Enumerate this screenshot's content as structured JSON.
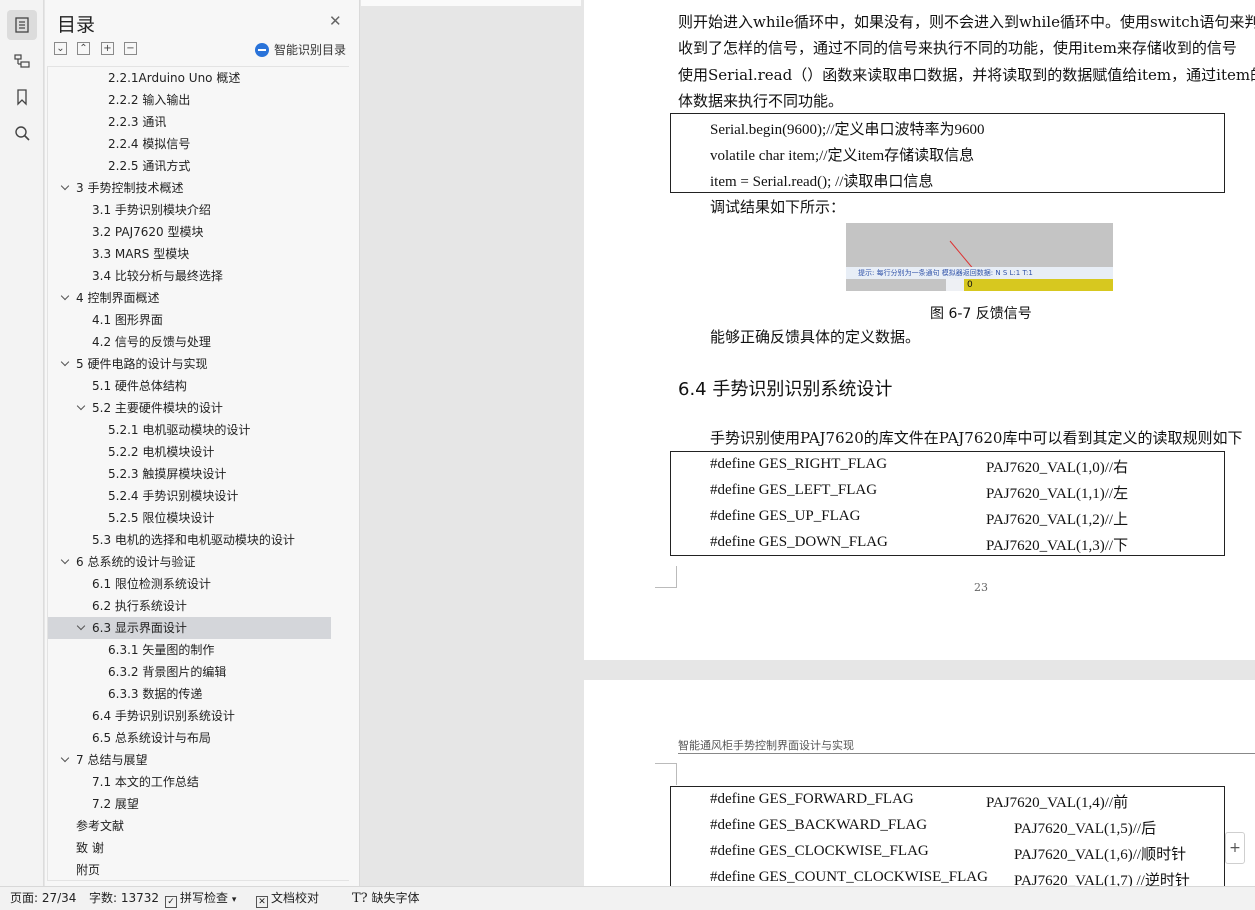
{
  "toc": {
    "title": "目录",
    "smart_toc_label": "智能识别目录",
    "items": [
      {
        "label": "2.2.1Arduino Uno 概述",
        "level": 3
      },
      {
        "label": "2.2.2 输入输出",
        "level": 3
      },
      {
        "label": "2.2.3 通讯",
        "level": 3
      },
      {
        "label": "2.2.4 模拟信号",
        "level": 3
      },
      {
        "label": "2.2.5 通讯方式",
        "level": 3
      },
      {
        "label": "3  手势控制技术概述",
        "level": 1,
        "expanded": true
      },
      {
        "label": "3.1 手势识别模块介绍",
        "level": 2
      },
      {
        "label": "3.2 PAJ7620 型模块",
        "level": 2
      },
      {
        "label": "3.3 MARS 型模块",
        "level": 2
      },
      {
        "label": "3.4 比较分析与最终选择",
        "level": 2
      },
      {
        "label": "4  控制界面概述",
        "level": 1,
        "expanded": true
      },
      {
        "label": "4.1 图形界面",
        "level": 2
      },
      {
        "label": "4.2 信号的反馈与处理",
        "level": 2
      },
      {
        "label": "5  硬件电路的设计与实现",
        "level": 1,
        "expanded": true
      },
      {
        "label": "5.1 硬件总体结构",
        "level": 2
      },
      {
        "label": "5.2 主要硬件模块的设计",
        "level": 2,
        "expanded": true
      },
      {
        "label": "5.2.1 电机驱动模块的设计",
        "level": 3
      },
      {
        "label": "5.2.2 电机模块设计",
        "level": 3
      },
      {
        "label": "5.2.3 触摸屏模块设计",
        "level": 3
      },
      {
        "label": "5.2.4 手势识别模块设计",
        "level": 3
      },
      {
        "label": "5.2.5 限位模块设计",
        "level": 3
      },
      {
        "label": "5.3 电机的选择和电机驱动模块的设计",
        "level": 2
      },
      {
        "label": "6  总系统的设计与验证",
        "level": 1,
        "expanded": true
      },
      {
        "label": "6.1 限位检测系统设计",
        "level": 2
      },
      {
        "label": "6.2 执行系统设计",
        "level": 2
      },
      {
        "label": "6.3 显示界面设计",
        "level": 2,
        "expanded": true,
        "selected": true
      },
      {
        "label": "6.3.1 矢量图的制作",
        "level": 3
      },
      {
        "label": "6.3.2 背景图片的编辑",
        "level": 3
      },
      {
        "label": "6.3.3 数据的传递",
        "level": 3
      },
      {
        "label": "6.4 手势识别识别系统设计",
        "level": 2
      },
      {
        "label": "6.5 总系统设计与布局",
        "level": 2
      },
      {
        "label": "7  总结与展望",
        "level": 1,
        "expanded": true
      },
      {
        "label": "7.1 本文的工作总结",
        "level": 2
      },
      {
        "label": "7.2 展望",
        "level": 2
      },
      {
        "label": "参考文献",
        "level": 1
      },
      {
        "label": "致    谢",
        "level": 1
      },
      {
        "label": "附页",
        "level": 1
      }
    ]
  },
  "doc": {
    "para1": [
      "则开始进入while循环中，如果没有，则不会进入到while循环中。使用switch语句来判断",
      "收到了怎样的信号，通过不同的信号来执行不同的功能，使用item来存储收到的信号",
      "使用Serial.read（）函数来读取串口数据，并将读取到的数据赋值给item，通过item的",
      "体数据来执行不同功能。"
    ],
    "code1": [
      "Serial.begin(9600);//定义串口波特率为9600",
      "volatile char item;//定义item存储读取信息",
      "item = Serial.read(); //读取串口信息"
    ],
    "debug_text": "调试结果如下所示：",
    "figure_hint": "提示: 每行分别为一条通句     模拟器返回数据:  N  S     L:1     T:1",
    "figure_value": "0",
    "figure_caption": "图 6-7 反馈信号",
    "after_fig": "能够正确反馈具体的定义数据。",
    "section_heading": "6.4 手势识别识别系统设计",
    "section_para": "手势识别使用PAJ7620的库文件在PAJ7620库中可以看到其定义的读取规则如下",
    "code2": [
      {
        "name": "#define GES_RIGHT_FLAG",
        "value": "PAJ7620_VAL(1,0)//右"
      },
      {
        "name": "#define GES_LEFT_FLAG",
        "value": "PAJ7620_VAL(1,1)//左"
      },
      {
        "name": "#define GES_UP_FLAG",
        "value": "PAJ7620_VAL(1,2)//上"
      },
      {
        "name": "#define GES_DOWN_FLAG",
        "value": "PAJ7620_VAL(1,3)//下"
      }
    ],
    "page_number": "23",
    "page2_header": "智能通风柜手势控制界面设计与实现",
    "code3": [
      {
        "name": "#define GES_FORWARD_FLAG",
        "value": "PAJ7620_VAL(1,4)//前"
      },
      {
        "name": "#define GES_BACKWARD_FLAG",
        "value": "PAJ7620_VAL(1,5)//后"
      },
      {
        "name": "#define GES_CLOCKWISE_FLAG",
        "value": "PAJ7620_VAL(1,6)//顺时针"
      },
      {
        "name": "#define GES_COUNT_CLOCKWISE_FLAG",
        "value": "PAJ7620_VAL(1,7) //逆时针"
      }
    ]
  },
  "status": {
    "page": "页面: 27/34",
    "words": "字数: 13732",
    "spell": "拼写检查",
    "proof": "文档校对",
    "missing_font": "缺失字体"
  }
}
